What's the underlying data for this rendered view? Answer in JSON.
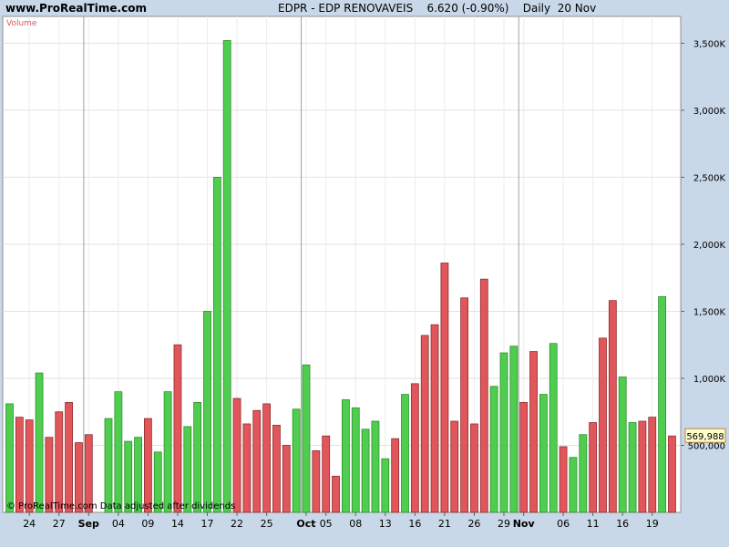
{
  "header": {
    "site": "www.ProRealTime.com",
    "instrument": "EDPR - EDP RENOVAVEIS",
    "price": "6.620 (-0.90%)",
    "period": "Daily  20 Nov"
  },
  "panel": {
    "indicator_label": "Volume",
    "copyright": "© ProRealTime.com  Data adjusted after dividends",
    "last_value_box": "569,988"
  },
  "colors": {
    "up": "#4fcd4f",
    "down": "#e0565a",
    "background": "#ffffff",
    "frame": "#c8d8e8"
  },
  "chart_data": {
    "type": "bar",
    "title": "",
    "xlabel": "",
    "ylabel": "Volume",
    "ylim": [
      0,
      3700000
    ],
    "yticks": [
      500000,
      1000000,
      1500000,
      2000000,
      2500000,
      3000000,
      3500000
    ],
    "ytick_labels": [
      "500,000",
      "1,000K",
      "1,500K",
      "2,000K",
      "2,500K",
      "3,000K",
      "3,500K"
    ],
    "xtick_labels": [
      {
        "label": "24",
        "bar": 2,
        "bold": false
      },
      {
        "label": "27",
        "bar": 5,
        "bold": false
      },
      {
        "label": "Sep",
        "bar": 8,
        "bold": true
      },
      {
        "label": "04",
        "bar": 11,
        "bold": false
      },
      {
        "label": "09",
        "bar": 14,
        "bold": false
      },
      {
        "label": "14",
        "bar": 17,
        "bold": false
      },
      {
        "label": "17",
        "bar": 20,
        "bold": false
      },
      {
        "label": "22",
        "bar": 23,
        "bold": false
      },
      {
        "label": "25",
        "bar": 26,
        "bold": false
      },
      {
        "label": "Oct",
        "bar": 30,
        "bold": true
      },
      {
        "label": "05",
        "bar": 32,
        "bold": false
      },
      {
        "label": "08",
        "bar": 35,
        "bold": false
      },
      {
        "label": "13",
        "bar": 38,
        "bold": false
      },
      {
        "label": "16",
        "bar": 41,
        "bold": false
      },
      {
        "label": "21",
        "bar": 44,
        "bold": false
      },
      {
        "label": "26",
        "bar": 47,
        "bold": false
      },
      {
        "label": "29",
        "bar": 50,
        "bold": false
      },
      {
        "label": "Nov",
        "bar": 52,
        "bold": true
      },
      {
        "label": "06",
        "bar": 56,
        "bold": false
      },
      {
        "label": "11",
        "bar": 59,
        "bold": false
      },
      {
        "label": "16",
        "bar": 62,
        "bold": false
      },
      {
        "label": "19",
        "bar": 65,
        "bold": false
      }
    ],
    "month_separators": [
      8,
      30,
      52
    ],
    "series": [
      {
        "direction": "up",
        "values": [
          810000,
          0,
          0,
          1040000,
          0,
          0,
          0,
          0,
          0,
          0,
          700000,
          900000,
          530000,
          560000,
          0,
          450000,
          900000,
          0,
          640000,
          820000,
          1500000,
          2500000,
          3520000,
          0,
          0,
          0,
          0,
          0,
          0,
          770000,
          1100000,
          0,
          0,
          0,
          840000,
          780000,
          620000,
          680000,
          400000,
          0,
          880000,
          0,
          0,
          0,
          0,
          0,
          0,
          0,
          0,
          940000,
          1190000,
          1240000,
          0,
          0,
          880000,
          1260000,
          0,
          410000,
          580000,
          0,
          0,
          0,
          1010000,
          670000,
          0,
          0,
          1610000,
          0
        ]
      },
      {
        "direction": "down",
        "values": [
          0,
          710000,
          690000,
          0,
          560000,
          750000,
          820000,
          520000,
          580000,
          0,
          0,
          0,
          0,
          0,
          700000,
          0,
          0,
          1250000,
          0,
          0,
          0,
          0,
          0,
          850000,
          660000,
          760000,
          810000,
          650000,
          500000,
          0,
          0,
          460000,
          570000,
          270000,
          0,
          0,
          0,
          0,
          0,
          550000,
          0,
          960000,
          1320000,
          1400000,
          1860000,
          680000,
          1600000,
          660000,
          1740000,
          0,
          0,
          0,
          820000,
          1200000,
          0,
          0,
          490000,
          0,
          0,
          670000,
          1300000,
          1580000,
          0,
          0,
          680000,
          710000,
          0,
          569988
        ]
      }
    ]
  }
}
